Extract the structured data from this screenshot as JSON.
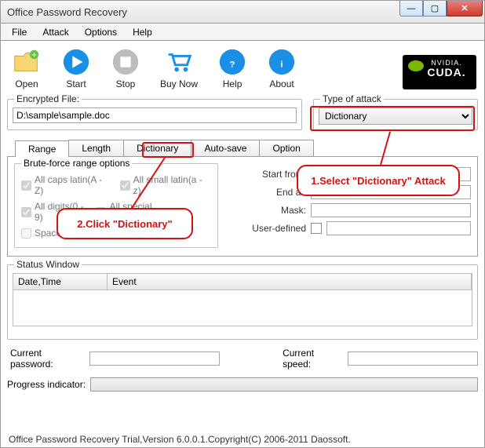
{
  "window": {
    "title": "Office Password Recovery"
  },
  "menu": {
    "items": [
      "File",
      "Attack",
      "Options",
      "Help"
    ]
  },
  "toolbar": {
    "open": "Open",
    "start": "Start",
    "stop": "Stop",
    "buynow": "Buy Now",
    "help": "Help",
    "about": "About",
    "cuda_brand": "NVIDIA.",
    "cuda_label": "CUDA."
  },
  "encrypted": {
    "legend": "Encrypted File:",
    "value": "D:\\sample\\sample.doc"
  },
  "attack": {
    "legend": "Type of attack",
    "selected": "Dictionary",
    "options": [
      "Dictionary"
    ]
  },
  "tabs": {
    "range": "Range",
    "length": "Length",
    "dictionary": "Dictionary",
    "autosave": "Auto-save",
    "option": "Option"
  },
  "brute": {
    "legend": "Brute-force range options",
    "opt_caps": "All caps latin(A - Z)",
    "opt_small": "All small latin(a - z)",
    "opt_digits": "All digits(0 - 9)",
    "opt_special": "All special symbols(!@#…)",
    "opt_space": "Space"
  },
  "fields": {
    "start": "Start from:",
    "end": "End at:",
    "mask": "Mask:",
    "user": "User-defined"
  },
  "status": {
    "legend": "Status Window",
    "col1": "Date,Time",
    "col2": "Event"
  },
  "bottom": {
    "cur_pwd": "Current password:",
    "cur_speed": "Current speed:",
    "progress": "Progress indicator:"
  },
  "statusbar": "Office Password Recovery Trial,Version 6.0.0.1.Copyright(C) 2006-2011 Daossoft.",
  "annotations": {
    "step1": "1.Select \"Dictionary\" Attack",
    "step2": "2.Click \"Dictionary\""
  }
}
